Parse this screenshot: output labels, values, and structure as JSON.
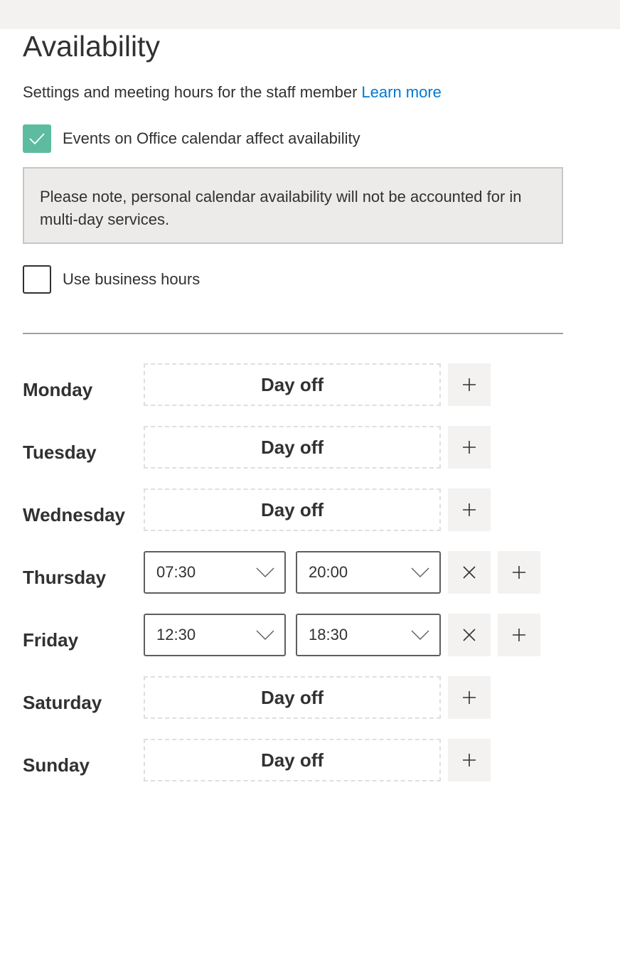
{
  "header": {
    "title": "Availability",
    "subtitle": "Settings and meeting hours for the staff member",
    "learn_more": "Learn more"
  },
  "options": {
    "office_calendar": {
      "label": "Events on Office calendar affect availability",
      "checked": true
    },
    "business_hours": {
      "label": "Use business hours",
      "checked": false
    }
  },
  "note": "Please note, personal calendar availability will not be accounted for in multi-day services.",
  "colors": {
    "accent_check": "#5dbc9f",
    "link": "#0078d4"
  },
  "days": [
    {
      "name": "Monday",
      "status": "Day off"
    },
    {
      "name": "Tuesday",
      "status": "Day off"
    },
    {
      "name": "Wednesday",
      "status": "Day off"
    },
    {
      "name": "Thursday",
      "start": "07:30",
      "end": "20:00"
    },
    {
      "name": "Friday",
      "start": "12:30",
      "end": "18:30"
    },
    {
      "name": "Saturday",
      "status": "Day off"
    },
    {
      "name": "Sunday",
      "status": "Day off"
    }
  ]
}
